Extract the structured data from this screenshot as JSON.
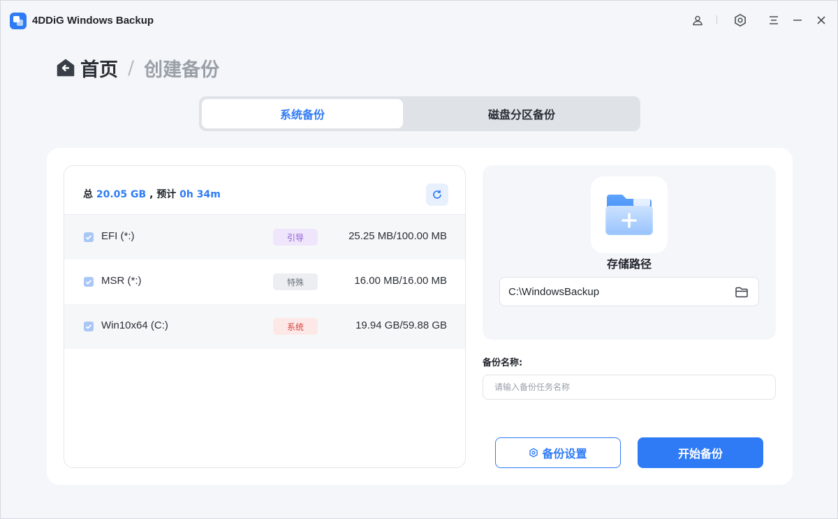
{
  "app": {
    "title": "4DDiG Windows Backup"
  },
  "breadcrumb": {
    "home": "首页",
    "separator": "/",
    "current": "创建备份"
  },
  "tabs": [
    {
      "label": "系统备份",
      "active": true
    },
    {
      "label": "磁盘分区备份",
      "active": false
    }
  ],
  "summary": {
    "total_prefix": "总",
    "total_value": "20.05 GB",
    "estimate_prefix": ", 预计",
    "estimate_value": "0h 34m"
  },
  "partitions": [
    {
      "name": "EFI (*:)",
      "badge": "引导",
      "size": "25.25 MB/100.00 MB",
      "checked": true
    },
    {
      "name": "MSR (*:)",
      "badge": "特殊",
      "size": "16.00 MB/16.00 MB",
      "checked": true
    },
    {
      "name": "Win10x64 (C:)",
      "badge": "系统",
      "size": "19.94 GB/59.88 GB",
      "checked": true
    }
  ],
  "storage": {
    "label": "存储路径",
    "path": "C:\\WindowsBackup"
  },
  "backup_name": {
    "label": "备份名称:",
    "placeholder": "请输入备份任务名称",
    "value": ""
  },
  "buttons": {
    "settings": "备份设置",
    "start": "开始备份"
  },
  "colors": {
    "accent": "#2f7bf5",
    "boot_badge": "#8d5ad6",
    "system_badge": "#d2483f"
  }
}
